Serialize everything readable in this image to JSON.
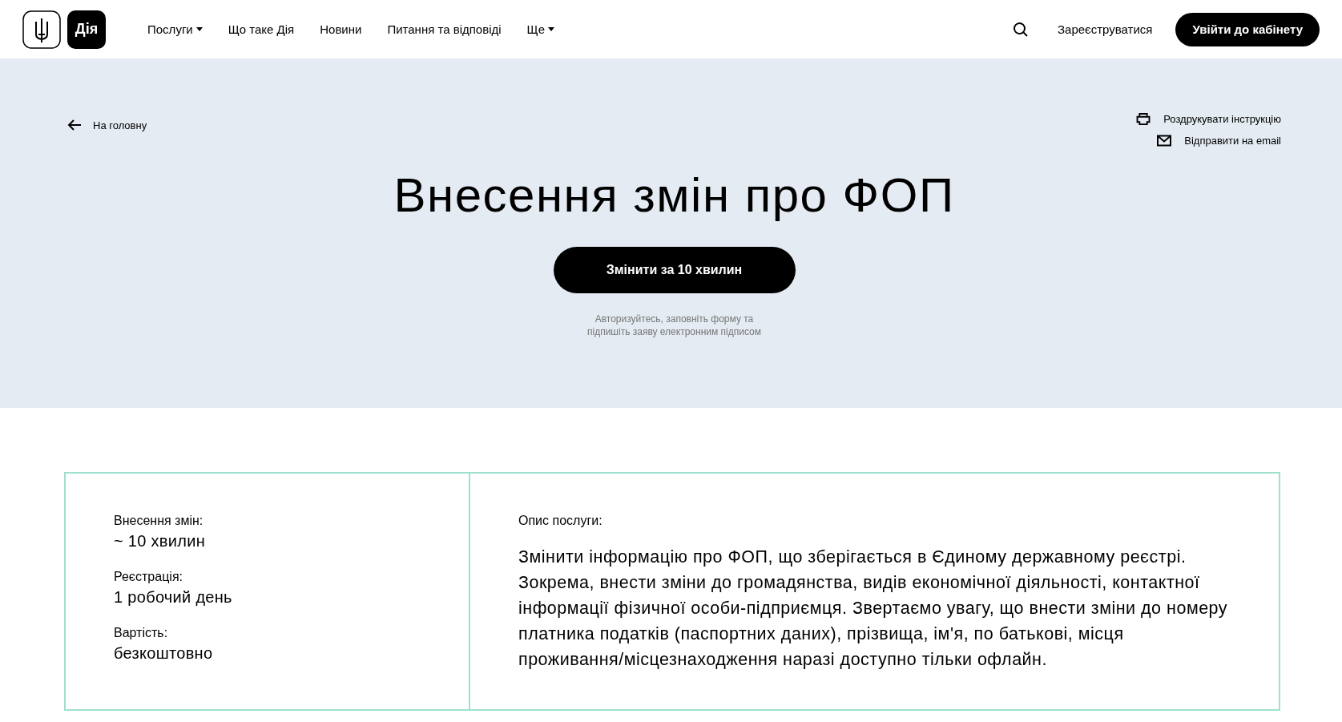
{
  "header": {
    "logo_text": "Дія",
    "nav": [
      {
        "label": "Послуги",
        "dropdown": true
      },
      {
        "label": "Що таке Дія",
        "dropdown": false
      },
      {
        "label": "Новини",
        "dropdown": false
      },
      {
        "label": "Питання та відповіді",
        "dropdown": false
      },
      {
        "label": "Ще",
        "dropdown": true
      }
    ],
    "register_link": "Зареєструватися",
    "login_button": "Увійти до кабінету"
  },
  "hero": {
    "back_link": "На головну",
    "actions": [
      {
        "kind": "print",
        "label": "Роздрукувати інструкцію"
      },
      {
        "kind": "email",
        "label": "Відправити на email"
      }
    ],
    "title": "Внесення змін про ФОП",
    "cta_button": "Змінити за 10 хвилин",
    "hint_lines": [
      "Авторизуйтесь, заповніть форму та",
      "підпишіть заяву електронним підписом"
    ]
  },
  "info": {
    "facts": [
      {
        "label": "Внесення змін:",
        "value": "~ 10 хвилин"
      },
      {
        "label": "Реєстрація:",
        "value": "1 робочий день"
      },
      {
        "label": "Вартість:",
        "value": "безкоштовно"
      }
    ],
    "description_label": "Опис послуги:",
    "description": "Змінити інформацію про ФОП, що зберігається в Єдиному державному реєстрі. Зокрема, внести зміни до громадянства, видів економічної діяльності, контактної інформації фізичної особи-підприємця. Звертаємо увагу, що внести зміни до номеру платника податків (паспортних даних), прізвища, ім'я, по батькові, місця проживання/місцезнаходження наразі доступно тільки офлайн."
  }
}
